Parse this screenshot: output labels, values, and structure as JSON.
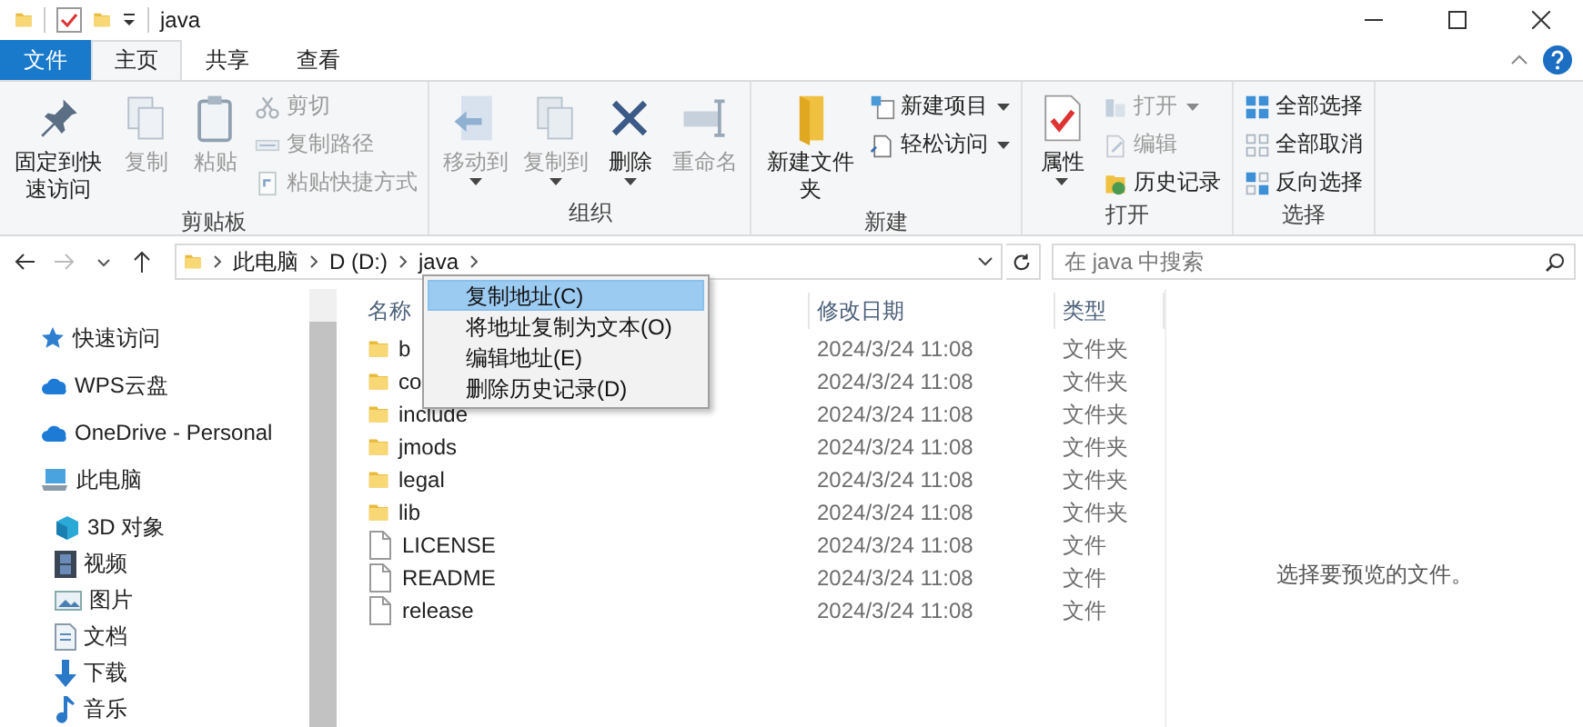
{
  "window": {
    "title": "java"
  },
  "tabs": [
    {
      "label": "文件",
      "kind": "file",
      "selected": false
    },
    {
      "label": "主页",
      "kind": "tab",
      "selected": true
    },
    {
      "label": "共享",
      "kind": "tab",
      "selected": false
    },
    {
      "label": "查看",
      "kind": "tab",
      "selected": false
    }
  ],
  "ribbon": {
    "groups": [
      {
        "label": "剪贴板",
        "items": [
          {
            "kind": "large",
            "label": "固定到快速访问",
            "disabled": false,
            "dropdown": false
          },
          {
            "kind": "large",
            "label": "复制",
            "disabled": true,
            "dropdown": false
          },
          {
            "kind": "large",
            "label": "粘贴",
            "disabled": true,
            "dropdown": false
          },
          {
            "kind": "stack",
            "items": [
              {
                "label": "剪切",
                "disabled": true,
                "dropdown": false
              },
              {
                "label": "复制路径",
                "disabled": true,
                "dropdown": false
              },
              {
                "label": "粘贴快捷方式",
                "disabled": true,
                "dropdown": false
              }
            ]
          }
        ]
      },
      {
        "label": "组织",
        "items": [
          {
            "kind": "large",
            "label": "移动到",
            "disabled": true,
            "dropdown": true
          },
          {
            "kind": "large",
            "label": "复制到",
            "disabled": true,
            "dropdown": true
          },
          {
            "kind": "large",
            "label": "删除",
            "disabled": false,
            "dropdown": true
          },
          {
            "kind": "large",
            "label": "重命名",
            "disabled": true,
            "dropdown": false
          }
        ]
      },
      {
        "label": "新建",
        "items": [
          {
            "kind": "large",
            "label": "新建文件夹",
            "disabled": false,
            "dropdown": false
          },
          {
            "kind": "stack",
            "items": [
              {
                "label": "新建项目",
                "disabled": false,
                "dropdown": true
              },
              {
                "label": "轻松访问",
                "disabled": false,
                "dropdown": true
              }
            ]
          }
        ]
      },
      {
        "label": "打开",
        "items": [
          {
            "kind": "large",
            "label": "属性",
            "disabled": false,
            "dropdown": true
          },
          {
            "kind": "stack",
            "items": [
              {
                "label": "打开",
                "disabled": true,
                "dropdown": true
              },
              {
                "label": "编辑",
                "disabled": true,
                "dropdown": false
              },
              {
                "label": "历史记录",
                "disabled": false,
                "dropdown": false
              }
            ]
          }
        ]
      },
      {
        "label": "选择",
        "items": [
          {
            "kind": "stack",
            "items": [
              {
                "label": "全部选择",
                "disabled": false,
                "dropdown": false
              },
              {
                "label": "全部取消",
                "disabled": false,
                "dropdown": false
              },
              {
                "label": "反向选择",
                "disabled": false,
                "dropdown": false
              }
            ]
          }
        ]
      }
    ]
  },
  "address_bar": {
    "path": [
      "此电脑",
      "D (D:)",
      "java"
    ]
  },
  "search": {
    "placeholder": "在 java 中搜索"
  },
  "sidebar": {
    "items": [
      {
        "label": "快速访问",
        "kind": "star"
      },
      {
        "label": "WPS云盘",
        "kind": "cloud"
      },
      {
        "label": "OneDrive - Personal",
        "kind": "cloud"
      },
      {
        "label": "此电脑",
        "kind": "pc",
        "children": [
          {
            "label": "3D 对象",
            "kind": "cube"
          },
          {
            "label": "视频",
            "kind": "video"
          },
          {
            "label": "图片",
            "kind": "image"
          },
          {
            "label": "文档",
            "kind": "doc"
          },
          {
            "label": "下载",
            "kind": "download"
          },
          {
            "label": "音乐",
            "kind": "music"
          }
        ]
      }
    ]
  },
  "file_list": {
    "columns": [
      "名称",
      "修改日期",
      "类型"
    ],
    "rows": [
      {
        "name": "b",
        "date": "2024/3/24 11:08",
        "type": "文件夹",
        "kind": "folder"
      },
      {
        "name": "co",
        "date": "2024/3/24 11:08",
        "type": "文件夹",
        "kind": "folder"
      },
      {
        "name": "include",
        "date": "2024/3/24 11:08",
        "type": "文件夹",
        "kind": "folder"
      },
      {
        "name": "jmods",
        "date": "2024/3/24 11:08",
        "type": "文件夹",
        "kind": "folder"
      },
      {
        "name": "legal",
        "date": "2024/3/24 11:08",
        "type": "文件夹",
        "kind": "folder"
      },
      {
        "name": "lib",
        "date": "2024/3/24 11:08",
        "type": "文件夹",
        "kind": "folder"
      },
      {
        "name": "LICENSE",
        "date": "2024/3/24 11:08",
        "type": "文件",
        "kind": "file"
      },
      {
        "name": "README",
        "date": "2024/3/24 11:08",
        "type": "文件",
        "kind": "file"
      },
      {
        "name": "release",
        "date": "2024/3/24 11:08",
        "type": "文件",
        "kind": "file"
      }
    ]
  },
  "context_menu": {
    "items": [
      {
        "label": "复制地址(C)",
        "selected": true
      },
      {
        "label": "将地址复制为文本(O)",
        "selected": false
      },
      {
        "label": "编辑地址(E)",
        "selected": false
      },
      {
        "label": "删除历史记录(D)",
        "selected": false
      }
    ]
  },
  "preview": {
    "message": "选择要预览的文件。"
  }
}
